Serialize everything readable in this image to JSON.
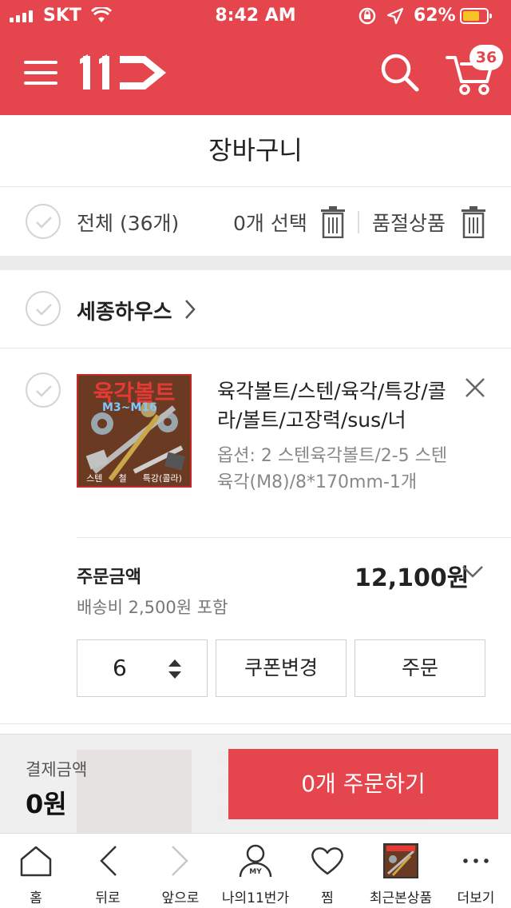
{
  "status_bar": {
    "carrier": "SKT",
    "time": "8:42 AM",
    "battery": "62%",
    "battery_level": 0.62
  },
  "header": {
    "logo_text": "11번가",
    "cart_count": "36",
    "brand_color": "#E5464D"
  },
  "page_title": "장바구니",
  "selection": {
    "all_label": "전체 (36개)",
    "selected_label": "0개 선택",
    "soldout_label": "품절상품"
  },
  "seller": {
    "name": "세종하우스"
  },
  "product": {
    "thumb_title": "육각볼트",
    "thumb_subtitle": "M3~M16",
    "thumb_tags": [
      "스텐",
      "철",
      "특강(콜라)"
    ],
    "name": "육각볼트/스텐/육각/특강/콜라/볼트/고장력/sus/너",
    "option": "옵션: 2 스텐육각볼트/2-5 스텐육각(M8)/8*170mm-1개",
    "order_amount_label": "주문금액",
    "order_amount": "12,100원",
    "shipping": "배송비 2,500원 포함",
    "quantity": "6",
    "coupon_label": "쿠폰변경",
    "order_label": "주문"
  },
  "checkout": {
    "pay_label": "결제금액",
    "pay_amount": "0원",
    "order_button": "0개 주문하기"
  },
  "bottom_nav": {
    "items": [
      {
        "label": "홈",
        "icon": "home-icon"
      },
      {
        "label": "뒤로",
        "icon": "back-icon"
      },
      {
        "label": "앞으로",
        "icon": "forward-icon"
      },
      {
        "label": "나의11번가",
        "icon": "my-icon",
        "icon_text": "MY"
      },
      {
        "label": "찜",
        "icon": "heart-icon"
      },
      {
        "label": "최근본상품",
        "icon": "recent-product-icon"
      },
      {
        "label": "더보기",
        "icon": "more-icon"
      }
    ]
  }
}
